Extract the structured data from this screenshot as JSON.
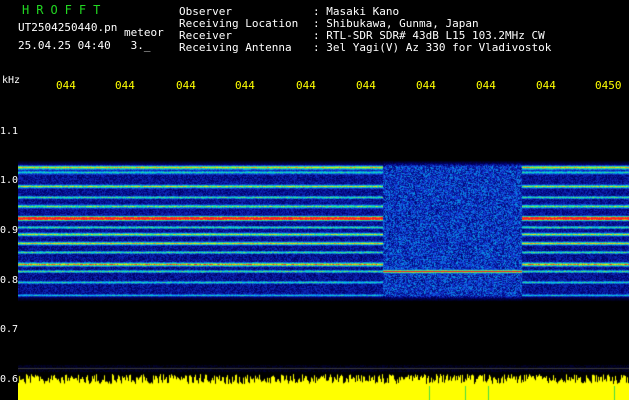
{
  "header": {
    "brand": "HROFFT",
    "file_name": "UT2504250440.pn",
    "file_suffix": "meteor",
    "datetime": "25.04.25 04:40",
    "datetime_extra": "3._"
  },
  "station_info": [
    {
      "label": "Observer",
      "value": ": Masaki Kano"
    },
    {
      "label": "Receiving Location",
      "value": ": Shibukawa, Gunma, Japan"
    },
    {
      "label": "Receiver",
      "value": ": RTL-SDR SDR# 43dB L15 103.2MHz CW"
    },
    {
      "label": "Receiving Antenna",
      "value": ": 3el Yagi(V) Az 330 for Vladivostok"
    }
  ],
  "axis": {
    "unit_label": "kHz",
    "y_labels": [
      "1.1",
      "1.0",
      "0.9",
      "0.8",
      "0.7",
      "0.6"
    ],
    "x_labels": [
      "044",
      "044",
      "044",
      "044",
      "044",
      "044",
      "044",
      "044",
      "044",
      "0450"
    ]
  },
  "colors": {
    "background": "#000000",
    "brand": "#22d822",
    "text": "#ffffff",
    "time_labels": "#ffff00",
    "signal_strong": "#ff2020",
    "noise_floor": "#ffff00"
  }
}
